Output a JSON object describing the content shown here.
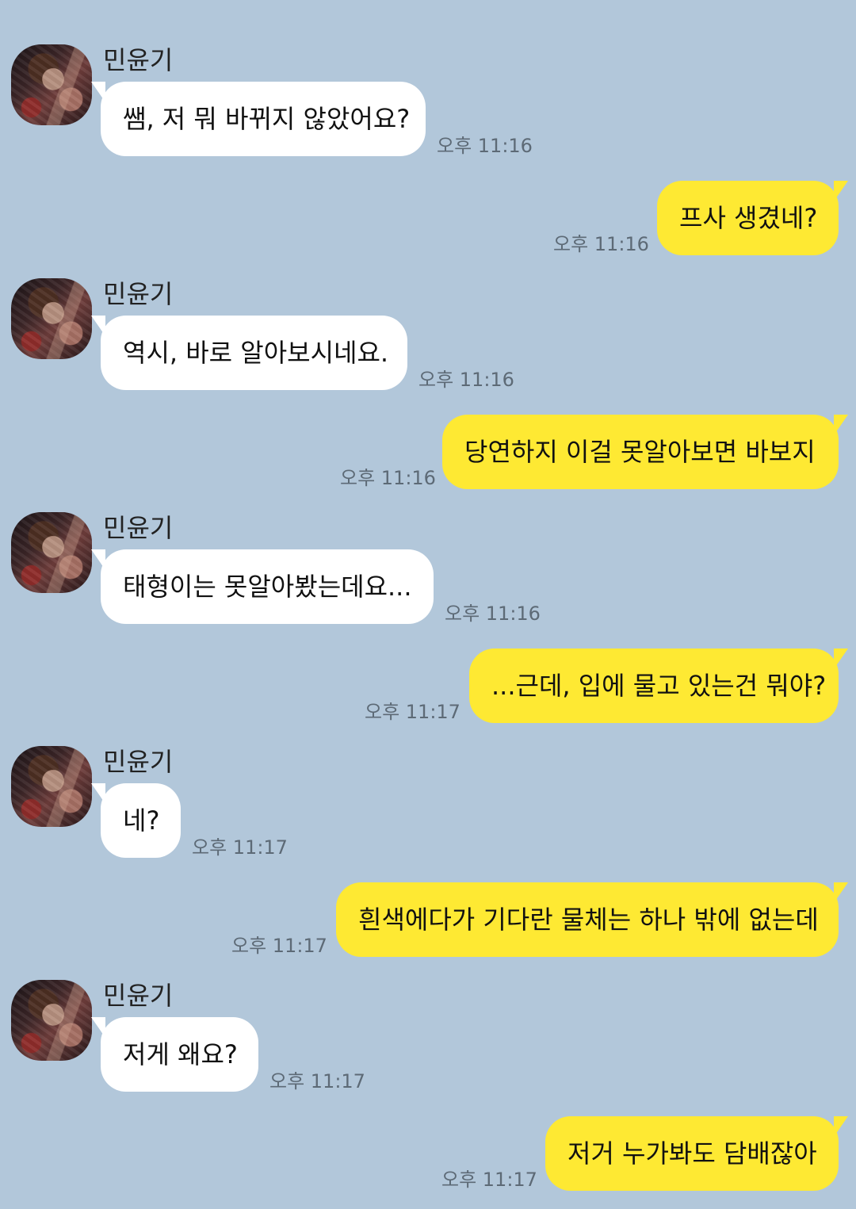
{
  "chat": {
    "messages": [
      {
        "direction": "incoming",
        "sender": "민윤기",
        "text": "쌤, 저 뭐 바뀌지 않았어요?",
        "time": "오후 11:16"
      },
      {
        "direction": "outgoing",
        "text": "프사 생겼네?",
        "time": "오후 11:16"
      },
      {
        "direction": "incoming",
        "sender": "민윤기",
        "text": "역시, 바로 알아보시네요.",
        "time": "오후 11:16"
      },
      {
        "direction": "outgoing",
        "text": "당연하지 이걸 못알아보면 바보지",
        "time": "오후 11:16"
      },
      {
        "direction": "incoming",
        "sender": "민윤기",
        "text": "태형이는 못알아봤는데요...",
        "time": "오후 11:16"
      },
      {
        "direction": "outgoing",
        "text": "...근데, 입에 물고 있는건 뭐야?",
        "time": "오후 11:17"
      },
      {
        "direction": "incoming",
        "sender": "민윤기",
        "text": "네?",
        "time": "오후 11:17"
      },
      {
        "direction": "outgoing",
        "text": "흰색에다가 기다란 물체는 하나 밖에 없는데",
        "time": "오후 11:17"
      },
      {
        "direction": "incoming",
        "sender": "민윤기",
        "text": "저게 왜요?",
        "time": "오후 11:17"
      },
      {
        "direction": "outgoing",
        "text": "저거 누가봐도 담배잖아",
        "time": "오후 11:17"
      }
    ]
  }
}
